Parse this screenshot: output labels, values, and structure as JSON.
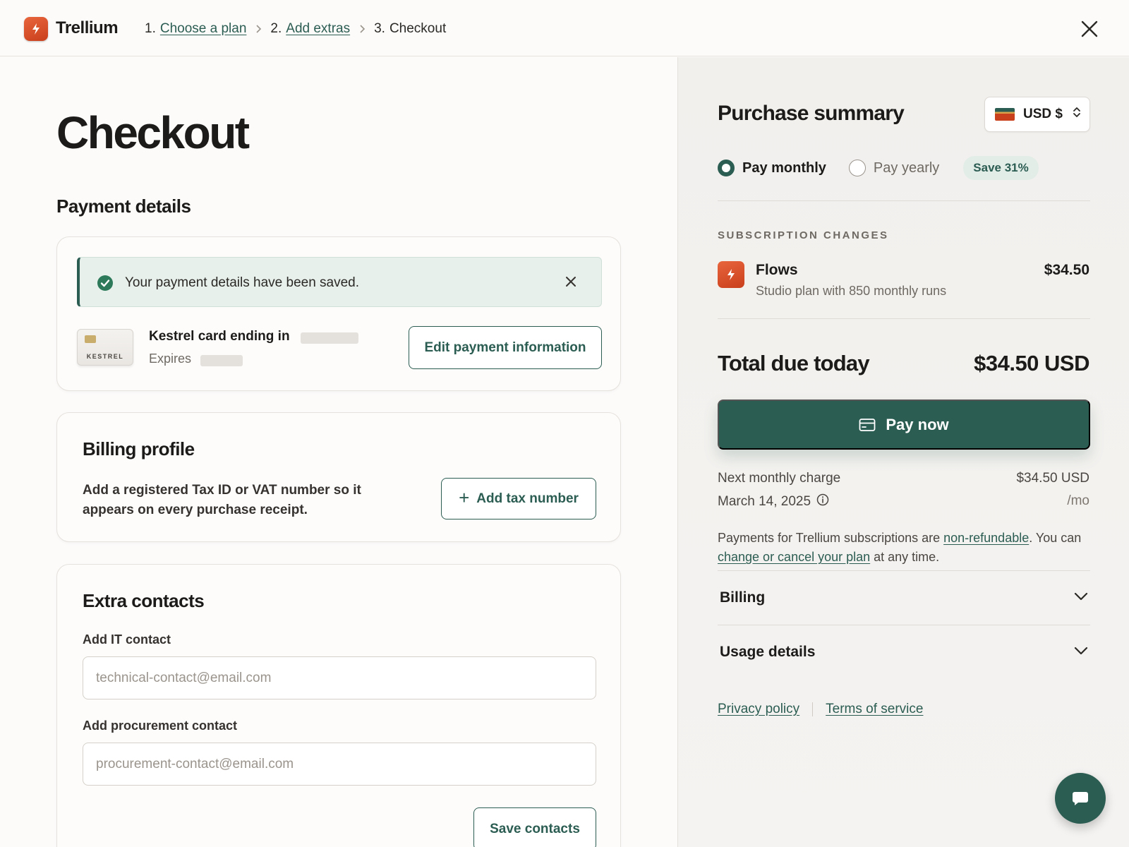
{
  "header": {
    "brand": "Trellium",
    "steps": [
      {
        "num": "1.",
        "label": "Choose a plan"
      },
      {
        "num": "2.",
        "label": "Add extras"
      },
      {
        "num": "3.",
        "label": "Checkout"
      }
    ],
    "step_separator_icon": "chevron-right-icon",
    "close_icon": "close-icon"
  },
  "checkout": {
    "title": "Checkout",
    "payment_details": {
      "title": "Payment details",
      "alert": "Your payment details have been saved.",
      "card_brand": "KESTREL",
      "card_label": "Kestrel card ending in",
      "expires_label": "Expires",
      "edit_button": "Edit payment information"
    },
    "billing_profile": {
      "title": "Billing profile",
      "description": "Add a registered Tax ID or VAT number so it appears on every purchase receipt.",
      "add_button": "Add tax number"
    },
    "extra_contacts": {
      "title": "Extra contacts",
      "it_label": "Add IT contact",
      "it_placeholder": "technical-contact@email.com",
      "procurement_label": "Add procurement contact",
      "procurement_placeholder": "procurement-contact@email.com",
      "save_button": "Save contacts"
    }
  },
  "summary": {
    "title": "Purchase summary",
    "currency": "USD $",
    "billing_period": {
      "monthly": "Pay monthly",
      "yearly": "Pay yearly",
      "selected": "monthly",
      "badge": "Save 31%"
    },
    "subscription_label": "SUBSCRIPTION CHANGES",
    "item": {
      "name": "Flows",
      "description": "Studio plan with 850 monthly runs",
      "price": "$34.50"
    },
    "total_label": "Total due today",
    "total_value": "$34.50 USD",
    "pay_button": "Pay now",
    "next_charge_label": "Next monthly charge",
    "next_charge_date": "March 14, 2025",
    "next_charge_price": "$34.50 USD",
    "next_charge_period": "/mo",
    "refund_note": {
      "part1": "Payments for Trellium subscriptions are ",
      "link1": "non-refundable",
      "part2": ". You can ",
      "link2": "change or cancel your plan",
      "part3": " at any time."
    },
    "accordions": [
      "Billing",
      "Usage details"
    ],
    "footer": {
      "privacy": "Privacy policy",
      "terms": "Terms of service"
    }
  },
  "colors": {
    "accent": "#2c5d52",
    "brand_orange": "#d9532a",
    "background": "#fcfbfa",
    "summary_background": "#f3f1ee"
  }
}
